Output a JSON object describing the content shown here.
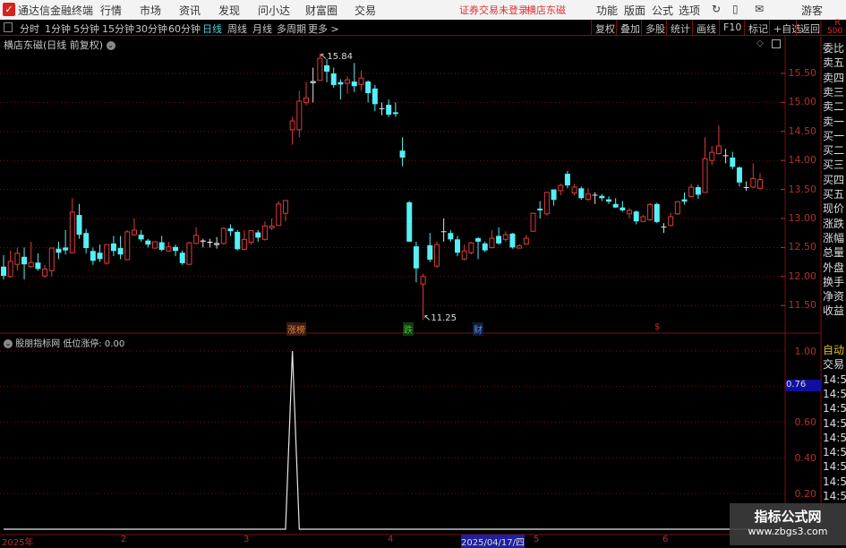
{
  "app": {
    "title": "通达信金融终端",
    "menu": [
      "行情",
      "市场",
      "资讯",
      "发现",
      "问小达",
      "财富圈",
      "交易"
    ],
    "login_status": "证券交易未登录",
    "stock_name_link": "横店东磁",
    "right_menu": [
      "功能",
      "版面",
      "公式",
      "选项"
    ],
    "user": "游客"
  },
  "toolbar": {
    "periods": [
      "分时",
      "1分钟",
      "5分钟",
      "15分钟",
      "30分钟",
      "60分钟",
      "日线",
      "周线",
      "月线",
      "多周期",
      "更多 >"
    ],
    "active_period": "日线",
    "buttons": [
      "复权",
      "叠加",
      "多股",
      "统计",
      "画线",
      "F10",
      "标记",
      "+自选",
      "返回"
    ],
    "r_badge": "R",
    "r_value": "500"
  },
  "chart": {
    "title": "横店东磁(日线 前复权)",
    "high_label": "15.84",
    "low_label": "11.25",
    "markers": [
      {
        "text": "涨榜",
        "color": "#e08040"
      },
      {
        "text": "跌",
        "color": "#40c040"
      },
      {
        "text": "财",
        "color": "#6090e0"
      },
      {
        "text": "$",
        "color": "#e02020"
      }
    ]
  },
  "indicator": {
    "name": "股朋指标网",
    "label": "低位涨停: 0.00",
    "crosshair_value": "0.76",
    "ticks": [
      "1.00",
      "0.60",
      "0.40",
      "0.20"
    ]
  },
  "date_axis": {
    "labels": [
      "2025年",
      "2",
      "3",
      "4",
      "5",
      "6"
    ],
    "cursor_date": "2025/04/17/四"
  },
  "right_panel": {
    "labels": [
      "委比",
      "卖五",
      "卖四",
      "卖三",
      "卖二",
      "卖一",
      "买一",
      "买二",
      "买三",
      "买四",
      "买五",
      "现价",
      "涨跌",
      "涨幅",
      "总量",
      "外盘",
      "换手",
      "净资",
      "收益"
    ],
    "auto": "自动",
    "trade": "交易",
    "times": [
      "14:56",
      "14:56",
      "14:56",
      "14:56",
      "14:56",
      "14:56",
      "14:56",
      "14:56",
      "14:56"
    ]
  },
  "watermark": {
    "line1": "指标公式网",
    "line2": "www.zbgs3.com"
  },
  "colors": {
    "up": "#e03a3a",
    "down": "#54f0f5",
    "doji": "#e0e0e0",
    "grid": "#7a1010",
    "axis": "#b03030"
  },
  "chart_data": {
    "type": "candlestick",
    "price_ticks": [
      11.5,
      12.0,
      12.5,
      13.0,
      13.5,
      14.0,
      14.5,
      15.0,
      15.5
    ],
    "ohlc": [
      [
        12.17,
        12.37,
        11.95,
        12.01
      ],
      [
        12.0,
        12.45,
        11.98,
        12.26
      ],
      [
        12.21,
        12.5,
        12.1,
        12.4
      ],
      [
        12.34,
        12.5,
        11.95,
        12.21
      ],
      [
        12.17,
        12.6,
        12.15,
        12.24
      ],
      [
        12.24,
        12.4,
        12.1,
        12.13
      ],
      [
        12.01,
        12.2,
        11.98,
        12.13
      ],
      [
        12.1,
        12.5,
        12.0,
        12.49
      ],
      [
        12.48,
        12.6,
        12.3,
        12.41
      ],
      [
        12.5,
        12.8,
        12.38,
        12.45
      ],
      [
        12.41,
        13.35,
        12.4,
        13.11
      ],
      [
        13.06,
        13.25,
        12.65,
        12.72
      ],
      [
        12.75,
        12.82,
        12.4,
        12.49
      ],
      [
        12.44,
        12.5,
        12.2,
        12.27
      ],
      [
        12.41,
        12.55,
        12.25,
        12.3
      ],
      [
        12.23,
        12.55,
        12.2,
        12.55
      ],
      [
        12.57,
        12.7,
        12.35,
        12.44
      ],
      [
        12.49,
        12.7,
        12.3,
        12.38
      ],
      [
        12.29,
        12.8,
        12.28,
        12.77
      ],
      [
        12.72,
        13.0,
        12.7,
        12.8
      ],
      [
        12.72,
        12.8,
        12.6,
        12.64
      ],
      [
        12.62,
        12.65,
        12.5,
        12.55
      ],
      [
        12.49,
        12.6,
        12.48,
        12.6
      ],
      [
        12.59,
        12.7,
        12.43,
        12.46
      ],
      [
        12.44,
        12.6,
        12.43,
        12.51
      ],
      [
        12.51,
        12.55,
        12.35,
        12.44
      ],
      [
        12.41,
        12.45,
        12.2,
        12.23
      ],
      [
        12.21,
        12.6,
        12.2,
        12.58
      ],
      [
        12.57,
        12.85,
        12.55,
        12.71
      ],
      [
        12.62,
        12.65,
        12.5,
        12.6
      ],
      [
        12.6,
        12.65,
        12.5,
        12.58
      ],
      [
        12.55,
        12.68,
        12.48,
        12.57
      ],
      [
        12.57,
        12.85,
        12.55,
        12.83
      ],
      [
        12.83,
        12.9,
        12.7,
        12.78
      ],
      [
        12.77,
        12.8,
        12.45,
        12.47
      ],
      [
        12.47,
        12.8,
        12.45,
        12.64
      ],
      [
        12.59,
        12.8,
        12.55,
        12.79
      ],
      [
        12.76,
        12.8,
        12.6,
        12.67
      ],
      [
        12.64,
        12.95,
        12.62,
        12.87
      ],
      [
        12.84,
        13.0,
        12.8,
        12.87
      ],
      [
        12.88,
        13.3,
        12.88,
        13.25
      ],
      [
        13.09,
        13.31,
        12.95,
        13.31
      ],
      [
        14.53,
        14.75,
        14.27,
        14.68
      ],
      [
        14.53,
        15.2,
        14.4,
        15.02
      ],
      [
        15.0,
        15.35,
        14.95,
        15.08
      ],
      [
        15.34,
        15.6,
        15.0,
        15.36
      ],
      [
        15.38,
        15.84,
        15.38,
        15.76
      ],
      [
        15.64,
        15.75,
        15.35,
        15.53
      ],
      [
        15.5,
        15.6,
        15.25,
        15.3
      ],
      [
        15.35,
        15.4,
        15.05,
        15.31
      ],
      [
        15.33,
        15.45,
        15.15,
        15.39
      ],
      [
        15.36,
        15.68,
        15.18,
        15.28
      ],
      [
        15.31,
        15.55,
        15.2,
        15.42
      ],
      [
        15.36,
        15.38,
        15.0,
        15.16
      ],
      [
        15.24,
        15.3,
        14.85,
        14.97
      ],
      [
        14.9,
        15.0,
        14.78,
        14.9
      ],
      [
        14.96,
        15.05,
        14.75,
        14.79
      ],
      [
        14.83,
        15.0,
        14.75,
        14.8
      ],
      [
        14.17,
        14.4,
        13.9,
        14.05
      ],
      [
        13.28,
        13.3,
        12.6,
        12.6
      ],
      [
        12.52,
        12.6,
        11.9,
        12.14
      ],
      [
        11.87,
        12.05,
        11.25,
        12.0
      ],
      [
        12.54,
        12.75,
        12.25,
        12.29
      ],
      [
        12.18,
        12.6,
        12.15,
        12.55
      ],
      [
        12.78,
        13.0,
        12.6,
        12.78
      ],
      [
        12.75,
        12.8,
        12.6,
        12.64
      ],
      [
        12.64,
        12.7,
        12.35,
        12.41
      ],
      [
        12.3,
        12.55,
        12.28,
        12.44
      ],
      [
        12.41,
        12.6,
        12.38,
        12.58
      ],
      [
        12.66,
        12.68,
        12.3,
        12.6
      ],
      [
        12.57,
        12.6,
        12.42,
        12.45
      ],
      [
        12.5,
        12.8,
        12.48,
        12.66
      ],
      [
        12.7,
        12.85,
        12.55,
        12.57
      ],
      [
        12.64,
        12.78,
        12.6,
        12.72
      ],
      [
        12.74,
        12.75,
        12.48,
        12.5
      ],
      [
        12.49,
        12.56,
        12.48,
        12.53
      ],
      [
        12.56,
        12.72,
        12.55,
        12.66
      ],
      [
        12.78,
        13.1,
        12.78,
        13.09
      ],
      [
        13.17,
        13.3,
        13.0,
        13.14
      ],
      [
        13.08,
        13.45,
        13.05,
        13.45
      ],
      [
        13.5,
        13.5,
        13.22,
        13.32
      ],
      [
        13.48,
        13.6,
        13.4,
        13.57
      ],
      [
        13.77,
        13.82,
        13.52,
        13.57
      ],
      [
        13.44,
        13.6,
        13.4,
        13.54
      ],
      [
        13.52,
        13.55,
        13.32,
        13.35
      ],
      [
        13.33,
        13.52,
        13.3,
        13.42
      ],
      [
        13.41,
        13.45,
        13.25,
        13.41
      ],
      [
        13.39,
        13.42,
        13.3,
        13.35
      ],
      [
        13.33,
        13.38,
        13.25,
        13.29
      ],
      [
        13.25,
        13.35,
        13.18,
        13.19
      ],
      [
        13.19,
        13.3,
        13.12,
        13.14
      ],
      [
        13.08,
        13.18,
        13.0,
        13.14
      ],
      [
        13.12,
        13.14,
        12.9,
        12.95
      ],
      [
        12.95,
        13.06,
        12.94,
        13.03
      ],
      [
        12.98,
        13.27,
        12.96,
        13.24
      ],
      [
        13.25,
        13.27,
        12.92,
        12.94
      ],
      [
        12.86,
        12.92,
        12.75,
        12.86
      ],
      [
        12.88,
        13.1,
        12.86,
        13.03
      ],
      [
        13.08,
        13.3,
        13.06,
        13.29
      ],
      [
        13.33,
        13.45,
        13.24,
        13.29
      ],
      [
        13.38,
        13.6,
        13.36,
        13.54
      ],
      [
        13.54,
        13.58,
        13.34,
        13.41
      ],
      [
        13.45,
        14.4,
        13.45,
        14.03
      ],
      [
        14.0,
        14.25,
        13.92,
        14.14
      ],
      [
        14.12,
        14.6,
        14.1,
        14.25
      ],
      [
        14.09,
        14.2,
        13.95,
        14.09
      ],
      [
        14.05,
        14.15,
        13.85,
        13.89
      ],
      [
        13.88,
        13.9,
        13.55,
        13.62
      ],
      [
        13.54,
        13.64,
        13.48,
        13.54
      ],
      [
        13.54,
        13.95,
        13.52,
        13.69
      ],
      [
        13.52,
        13.78,
        13.5,
        13.67
      ]
    ],
    "indicator_values_nonzero": {
      "index": 42,
      "value": 1
    },
    "indicator_ylim": [
      0,
      1
    ]
  }
}
